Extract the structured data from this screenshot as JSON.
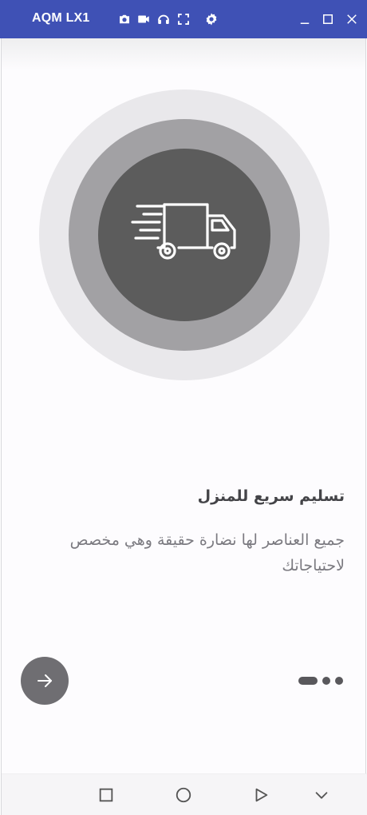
{
  "window": {
    "title": "AQM LX1",
    "toolbar_icons": [
      "camera-icon",
      "video-icon",
      "headphones-icon",
      "fullscreen-icon",
      "settings-icon"
    ],
    "controls": [
      "minimize-icon",
      "maximize-icon",
      "close-icon"
    ],
    "accent_color": "#3f51b5"
  },
  "onboarding": {
    "illustration_icon": "delivery-truck-icon",
    "title": "تسليم سريع للمنزل",
    "description": "جميع العناصر لها نضارة حقيقة وهي مخصص لاحتياجاتك",
    "next_button_icon": "arrow-right-icon",
    "page_count": 3,
    "current_page": 1
  },
  "navigation_bar": {
    "buttons": [
      "recents-square-icon",
      "home-circle-icon",
      "back-triangle-icon",
      "collapse-chevron-icon"
    ]
  }
}
